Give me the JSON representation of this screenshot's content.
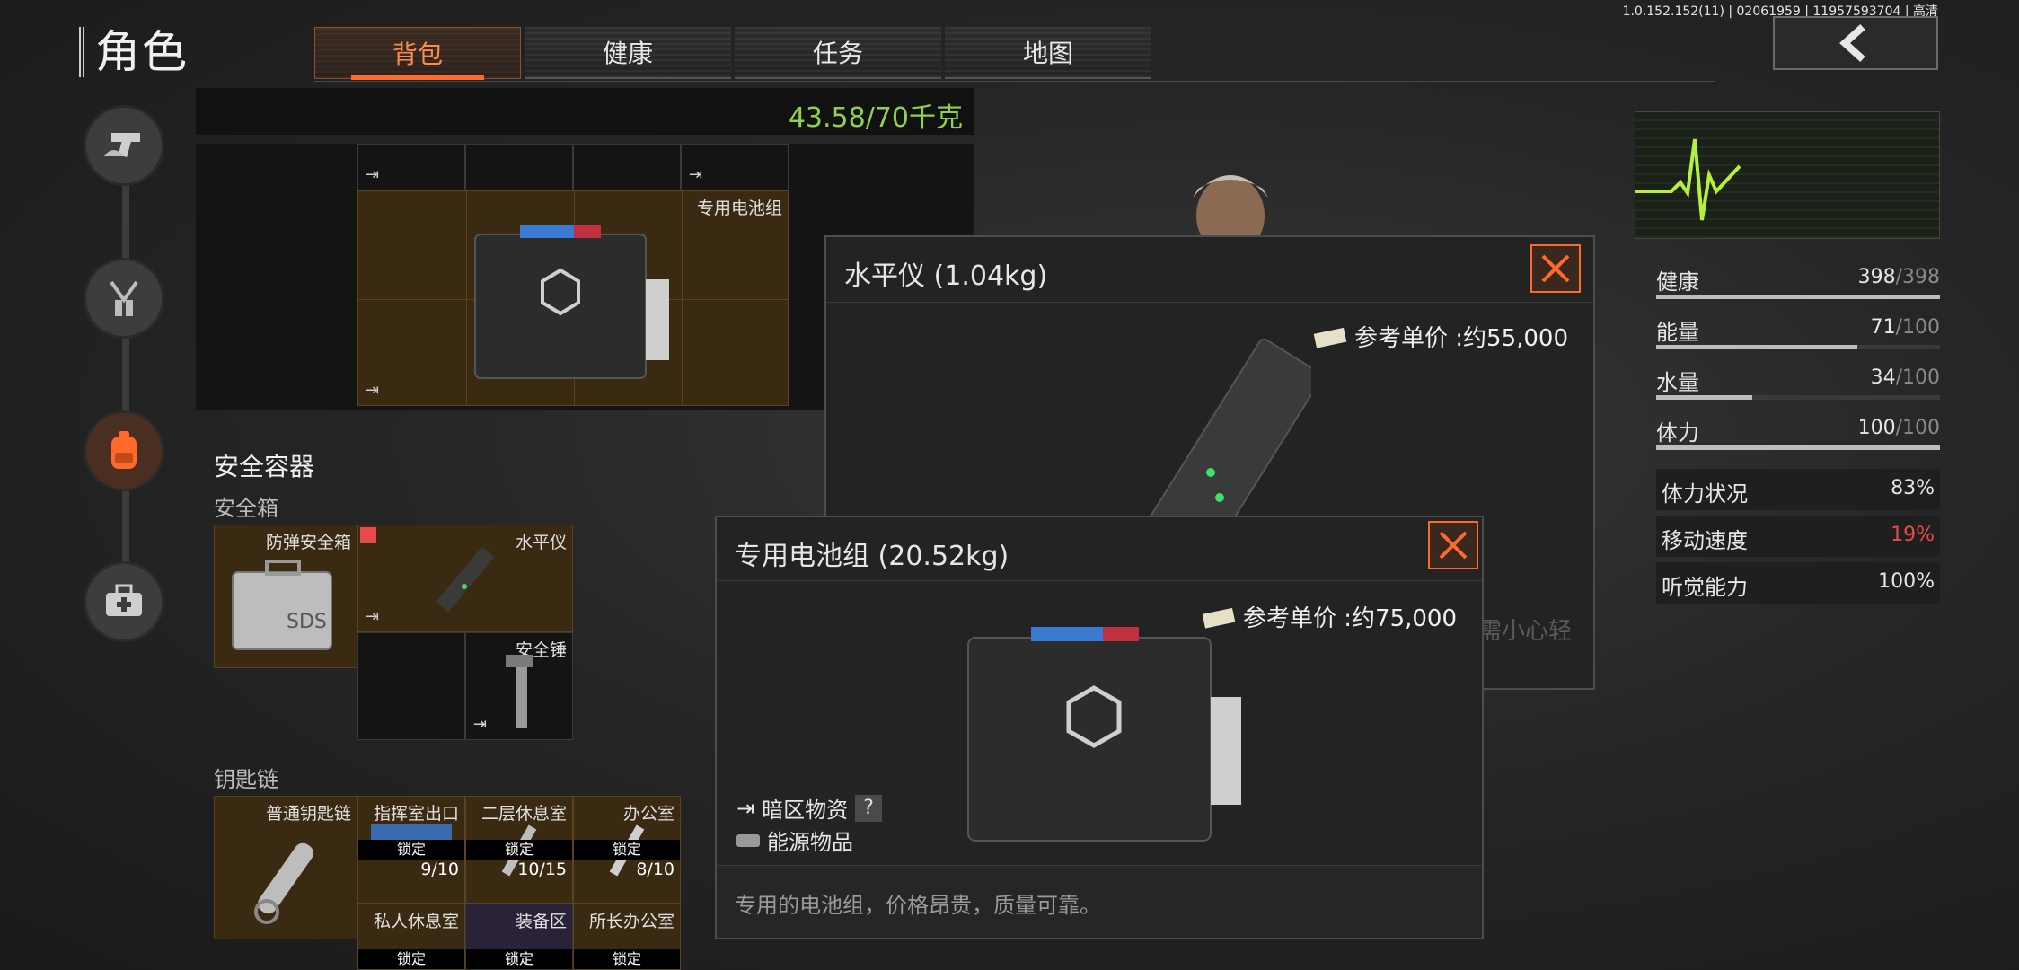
{
  "version_text": "1.0.152.152(11) | 02061959 | 11957593704 | 高清",
  "page_title": "角色",
  "tabs": [
    {
      "label": "背包"
    },
    {
      "label": "健康"
    },
    {
      "label": "任务"
    },
    {
      "label": "地图"
    }
  ],
  "inventory": {
    "weight": "43.58/70千克",
    "top_grid_label": "专用电池组"
  },
  "safe_container": {
    "title": "安全容器",
    "box_title": "安全箱",
    "items": [
      {
        "label": "防弹安全箱"
      },
      {
        "label": "水平仪"
      },
      {
        "label": "安全锤"
      }
    ]
  },
  "keychain": {
    "title": "钥匙链",
    "chain_label": "普通钥匙链",
    "keys": [
      {
        "label": "指挥室出口",
        "lock": "锁定",
        "count": "9/10"
      },
      {
        "label": "二层休息室",
        "lock": "锁定",
        "count": "10/15"
      },
      {
        "label": "办公室",
        "lock": "锁定",
        "count": "8/10"
      },
      {
        "label": "私人休息室",
        "lock": "锁定"
      },
      {
        "label": "装备区",
        "lock": "锁定"
      },
      {
        "label": "所长办公室",
        "lock": "锁定"
      }
    ]
  },
  "stats": [
    {
      "label": "健康",
      "value": "398",
      "max": "/398",
      "fraction": 1.0
    },
    {
      "label": "能量",
      "value": "71",
      "max": "/100",
      "fraction": 0.71
    },
    {
      "label": "水量",
      "value": "34",
      "max": "/100",
      "fraction": 0.34
    },
    {
      "label": "体力",
      "value": "100",
      "max": "/100",
      "fraction": 1.0
    }
  ],
  "conditions": [
    {
      "label": "体力状况",
      "value": "83%",
      "color": "#e6e6e6"
    },
    {
      "label": "移动速度",
      "value": "19%",
      "color": "#e84a4a"
    },
    {
      "label": "听觉能力",
      "value": "100%",
      "color": "#e6e6e6"
    }
  ],
  "popup_level": {
    "title": "水平仪 (1.04kg)",
    "price": "参考单价 :约55,000",
    "hidden_desc_fragment": "需小心轻"
  },
  "popup_battery": {
    "title": "专用电池组 (20.52kg)",
    "price": "参考单价 :约75,000",
    "tag1": "暗区物资",
    "tag1_badge": "?",
    "tag2": "能源物品",
    "description": "专用的电池组，价格昂贵，质量可靠。"
  },
  "colors": {
    "accent": "#ff6a2c",
    "weight_green": "#8fd14f",
    "heart_green": "#b6f03c"
  }
}
